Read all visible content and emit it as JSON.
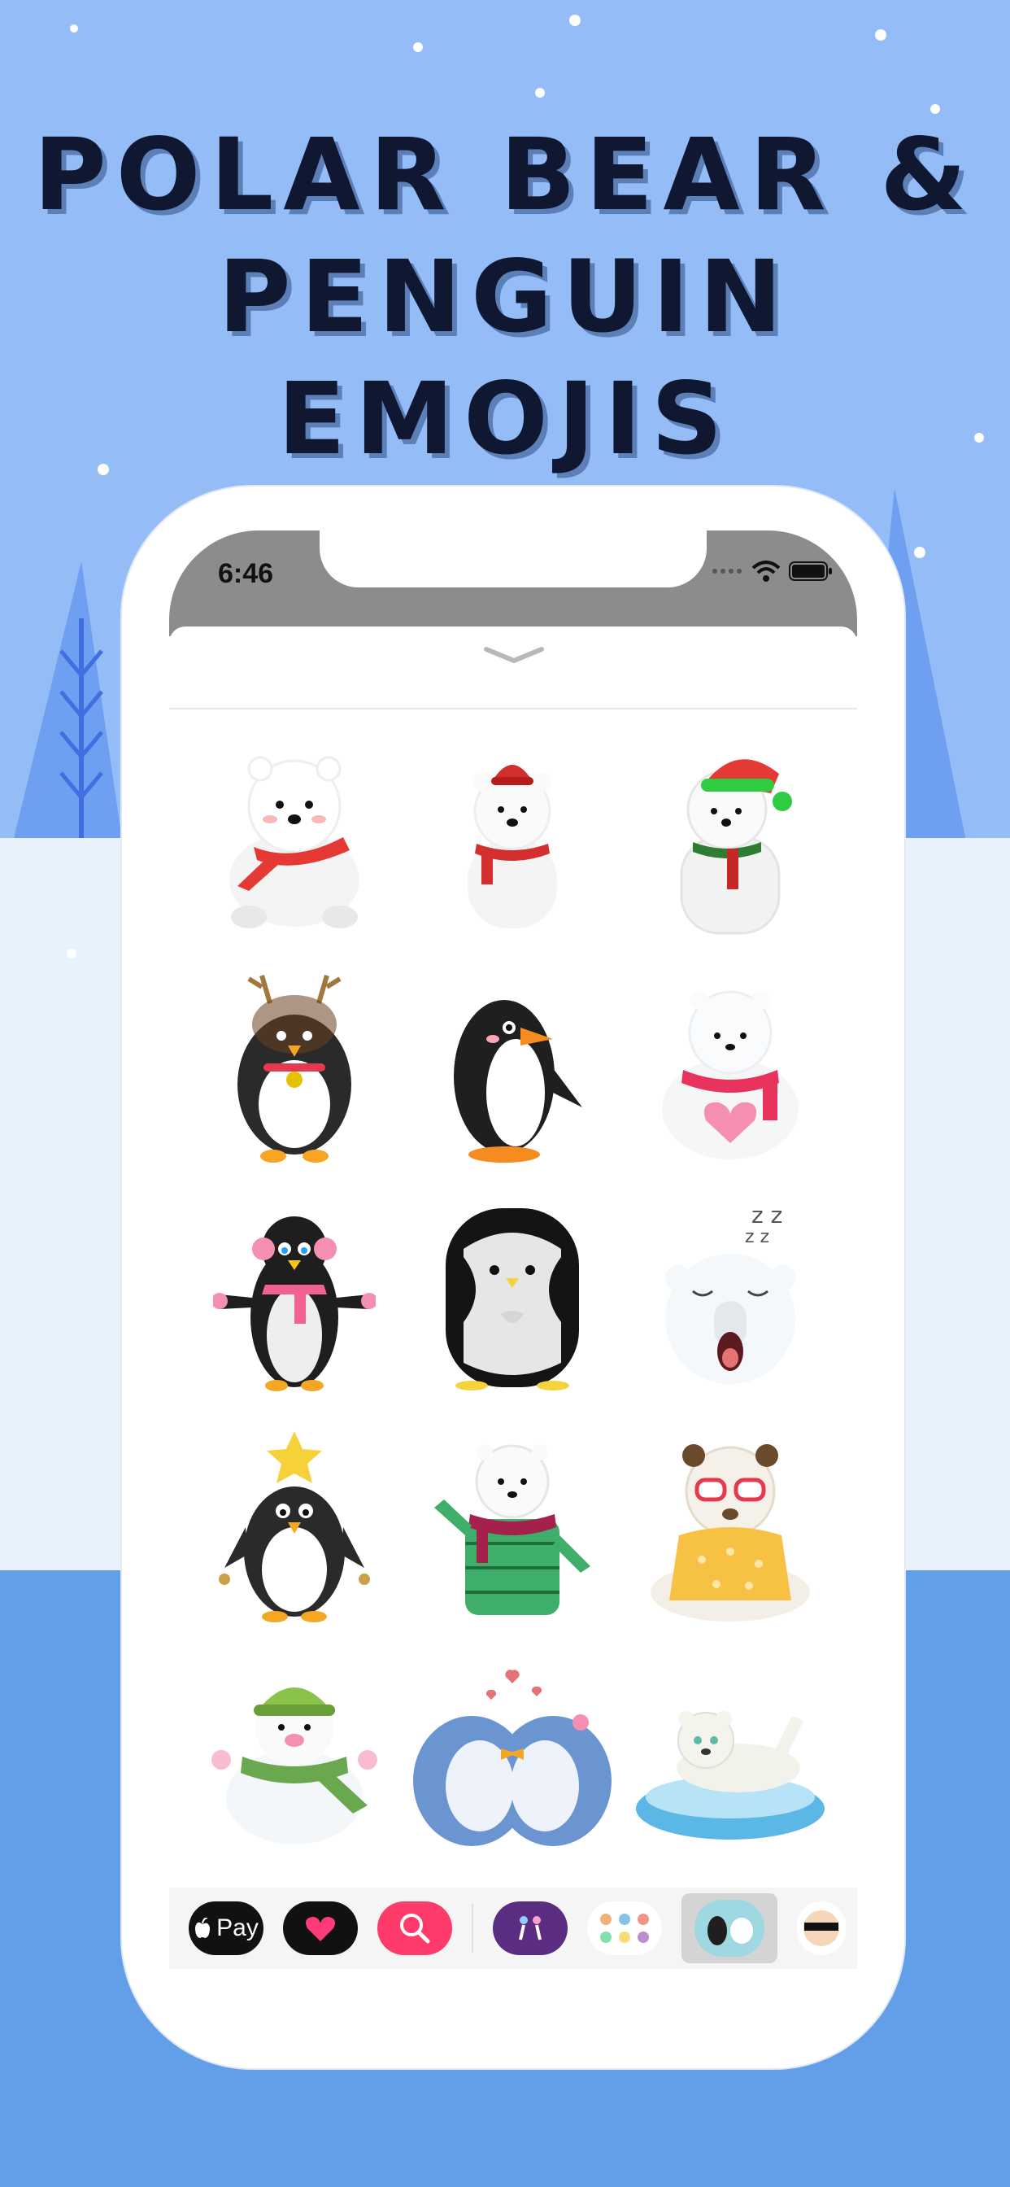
{
  "hero": {
    "title_line1": "POLAR BEAR &",
    "title_line2": "PENGUIN EMOJIS"
  },
  "status": {
    "time": "6:46"
  },
  "sticker_grid": {
    "stickers": [
      {
        "name": "polar-bear-red-scarf"
      },
      {
        "name": "polar-bear-red-hat"
      },
      {
        "name": "polar-bear-santa-hat"
      },
      {
        "name": "penguin-reindeer-antlers"
      },
      {
        "name": "penguin-orange-beak"
      },
      {
        "name": "polar-bear-holding-heart"
      },
      {
        "name": "penguin-pink-earmuffs"
      },
      {
        "name": "penguin-round-black"
      },
      {
        "name": "polar-bear-sleeping"
      },
      {
        "name": "penguin-christmas-star"
      },
      {
        "name": "polar-bear-knit-sweater"
      },
      {
        "name": "polar-bear-glasses-yellow"
      },
      {
        "name": "polar-bear-green-hat-scarf"
      },
      {
        "name": "penguins-kissing-hearts"
      },
      {
        "name": "polar-bear-on-ice"
      }
    ]
  },
  "app_drawer": {
    "apple_pay_label": "Pay"
  },
  "colors": {
    "sky": "#94bdf7",
    "lake": "#639ee9",
    "title": "#0f1830",
    "scarf_red": "#e53935",
    "penguin_black": "#1f1f1f"
  }
}
